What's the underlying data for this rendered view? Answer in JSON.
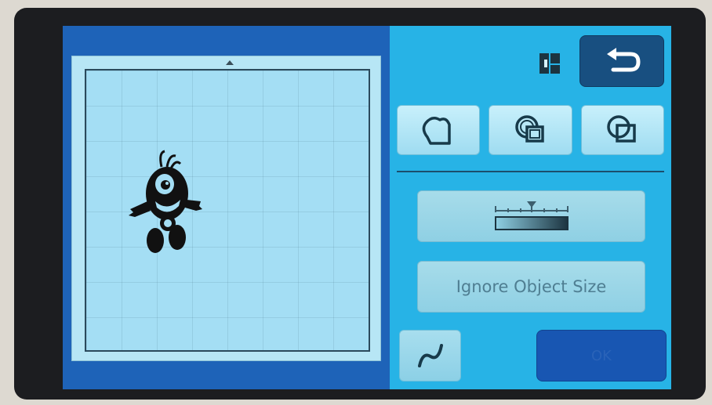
{
  "controls": {
    "ignore_object_size_label": "Ignore Object Size",
    "ok_label": "OK"
  },
  "icons": {
    "layout": "layout-toggle-icon",
    "back": "return-arrow-icon",
    "outline_shape": "outline-shape-icon",
    "offset_overlap": "offset-overlap-icon",
    "overlap_squares": "overlapping-squares-icon",
    "slider": "distance-slider-icon",
    "curve": "curve-icon"
  },
  "colors": {
    "screen_bg": "#27b3e6",
    "preview_bg": "#1e63b8",
    "back_button": "#184f80",
    "ok_button": "#1856b2"
  }
}
